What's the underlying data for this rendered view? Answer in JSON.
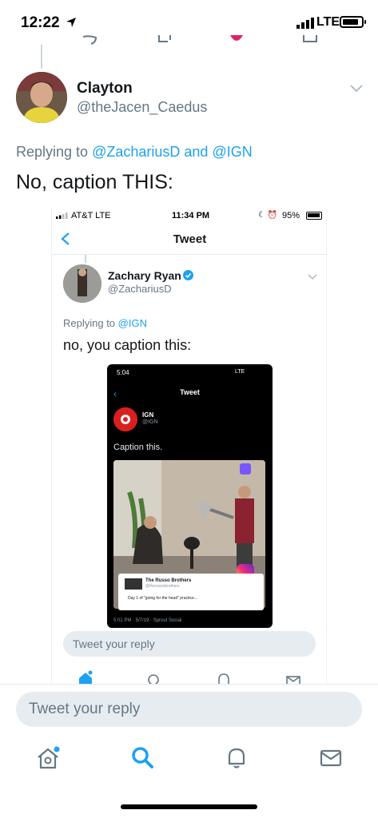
{
  "status_bar": {
    "time": "12:22",
    "network": "LTE"
  },
  "tweet": {
    "author_name": "Clayton",
    "author_handle": "@theJacen_Caedus",
    "replying_prefix": "Replying to",
    "replying_user1": "@ZachariusD",
    "replying_and": "and",
    "replying_user2": "@IGN",
    "text": "No, caption THIS:"
  },
  "embedded": {
    "status": {
      "carrier": "AT&T  LTE",
      "time": "11:34 PM",
      "battery": "95%"
    },
    "header_title": "Tweet",
    "author_name": "Zachary Ryan",
    "author_handle": "@ZachariusD",
    "replying_prefix": "Replying to",
    "replying_user": "@IGN",
    "text": "no, you caption this:",
    "reply_placeholder": "Tweet your reply",
    "inner": {
      "time": "5:04",
      "status_right": "LTE",
      "header_title": "Tweet",
      "author_name": "IGN",
      "author_handle": "@IGN",
      "text": "Caption this.",
      "card_name": "The Russo Brothers",
      "card_handle": "@therussobrothers",
      "card_text": "Day 1 of \"going for the head\" practice...",
      "footer": "5:01 PM · 5/7/19 · Sprout Social"
    }
  },
  "reply_placeholder": "Tweet your reply",
  "tabs": [
    "home",
    "search",
    "notifications",
    "messages"
  ],
  "colors": {
    "accent": "#1da1f2",
    "muted": "#657786",
    "reply_bg": "#e6ecf0"
  }
}
